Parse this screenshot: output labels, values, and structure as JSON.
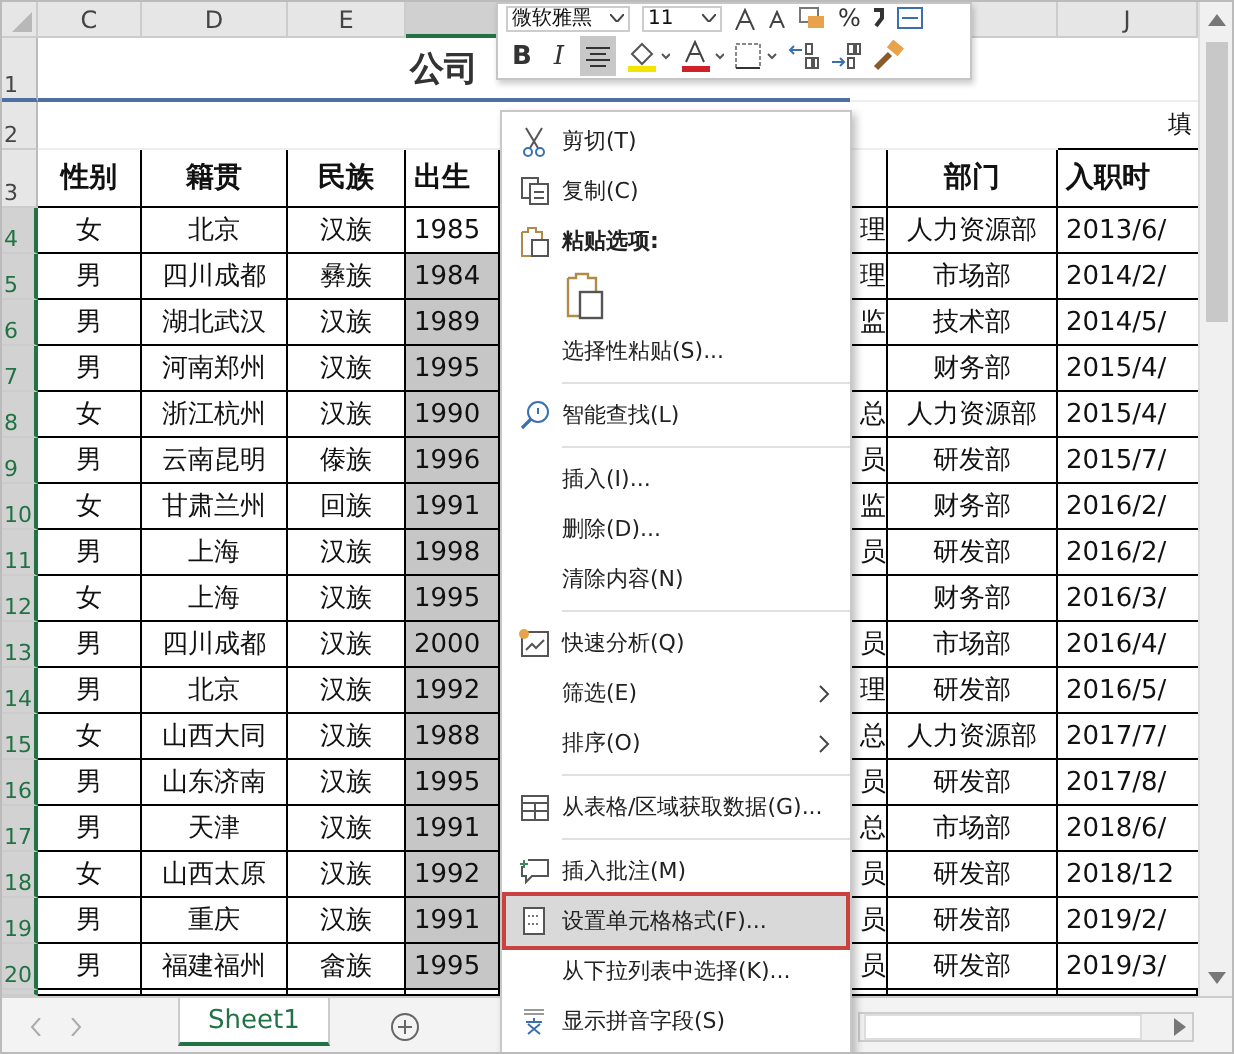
{
  "toolbar": {
    "font": "微软雅黑",
    "size": "11",
    "bold": "B",
    "italic": "I",
    "percent": "%",
    "align_pressed": true
  },
  "column_headers": [
    {
      "label": "C"
    },
    {
      "label": "D"
    },
    {
      "label": "E"
    },
    {
      "label": "J"
    }
  ],
  "title_row": {
    "row": "1",
    "text": "公司"
  },
  "note_row": {
    "row": "2",
    "text": "填"
  },
  "header_row": {
    "row": "3",
    "gender": "性别",
    "origin": "籍贯",
    "ethnicity": "民族",
    "birth": "出生",
    "department": "部门",
    "hire_date": "入职时"
  },
  "rows": [
    {
      "row": "4",
      "selected": true,
      "active": true,
      "gender": "女",
      "origin": "北京",
      "ethnicity": "汉族",
      "birth": "1985",
      "column_h": "理",
      "department": "人力资源部",
      "hire_date": "2013/6/"
    },
    {
      "row": "5",
      "selected": true,
      "active": false,
      "gender": "男",
      "origin": "四川成都",
      "ethnicity": "彝族",
      "birth": "1984",
      "column_h": "理",
      "department": "市场部",
      "hire_date": "2014/2/"
    },
    {
      "row": "6",
      "selected": true,
      "active": false,
      "gender": "男",
      "origin": "湖北武汉",
      "ethnicity": "汉族",
      "birth": "1989",
      "column_h": "监",
      "department": "技术部",
      "hire_date": "2014/5/"
    },
    {
      "row": "7",
      "selected": true,
      "active": false,
      "gender": "男",
      "origin": "河南郑州",
      "ethnicity": "汉族",
      "birth": "1995",
      "department": "财务部",
      "hire_date": "2015/4/"
    },
    {
      "row": "8",
      "selected": true,
      "active": false,
      "gender": "女",
      "origin": "浙江杭州",
      "ethnicity": "汉族",
      "birth": "1990",
      "column_h": "总",
      "department": "人力资源部",
      "hire_date": "2015/4/"
    },
    {
      "row": "9",
      "selected": true,
      "active": false,
      "gender": "男",
      "origin": "云南昆明",
      "ethnicity": "傣族",
      "birth": "1996",
      "column_h": "员",
      "department": "研发部",
      "hire_date": "2015/7/"
    },
    {
      "row": "10",
      "selected": true,
      "active": false,
      "gender": "女",
      "origin": "甘肃兰州",
      "ethnicity": "回族",
      "birth": "1991",
      "column_h": "监",
      "department": "财务部",
      "hire_date": "2016/2/"
    },
    {
      "row": "11",
      "selected": true,
      "active": false,
      "gender": "男",
      "origin": "上海",
      "ethnicity": "汉族",
      "birth": "1998",
      "column_h": "员",
      "department": "研发部",
      "hire_date": "2016/2/"
    },
    {
      "row": "12",
      "selected": true,
      "active": false,
      "gender": "女",
      "origin": "上海",
      "ethnicity": "汉族",
      "birth": "1995",
      "department": "财务部",
      "hire_date": "2016/3/"
    },
    {
      "row": "13",
      "selected": true,
      "active": false,
      "gender": "男",
      "origin": "四川成都",
      "ethnicity": "汉族",
      "birth": "2000",
      "column_h": "员",
      "department": "市场部",
      "hire_date": "2016/4/"
    },
    {
      "row": "14",
      "selected": true,
      "active": false,
      "gender": "男",
      "origin": "北京",
      "ethnicity": "汉族",
      "birth": "1992",
      "column_h": "理",
      "department": "研发部",
      "hire_date": "2016/5/"
    },
    {
      "row": "15",
      "selected": true,
      "active": false,
      "gender": "女",
      "origin": "山西大同",
      "ethnicity": "汉族",
      "birth": "1988",
      "column_h": "总",
      "department": "人力资源部",
      "hire_date": "2017/7/"
    },
    {
      "row": "16",
      "selected": true,
      "active": false,
      "gender": "男",
      "origin": "山东济南",
      "ethnicity": "汉族",
      "birth": "1995",
      "column_h": "员",
      "department": "研发部",
      "hire_date": "2017/8/"
    },
    {
      "row": "17",
      "selected": true,
      "active": false,
      "gender": "男",
      "origin": "天津",
      "ethnicity": "汉族",
      "birth": "1991",
      "column_h": "总",
      "department": "市场部",
      "hire_date": "2018/6/"
    },
    {
      "row": "18",
      "selected": true,
      "active": false,
      "gender": "女",
      "origin": "山西太原",
      "ethnicity": "汉族",
      "birth": "1992",
      "column_h": "员",
      "department": "研发部",
      "hire_date": "2018/12"
    },
    {
      "row": "19",
      "selected": true,
      "active": false,
      "gender": "男",
      "origin": "重庆",
      "ethnicity": "汉族",
      "birth": "1991",
      "column_h": "员",
      "department": "研发部",
      "hire_date": "2019/2/"
    },
    {
      "row": "20",
      "selected": true,
      "active": false,
      "gender": "男",
      "origin": "福建福州",
      "ethnicity": "畲族",
      "birth": "1995",
      "column_h": "员",
      "department": "研发部",
      "hire_date": "2019/3/"
    }
  ],
  "sheet_tabs": [
    {
      "label": "Sheet1",
      "selected": true
    }
  ],
  "context_menu": [
    {
      "kind": "command",
      "label": "剪切(T)",
      "has_submenu": false,
      "selected": false
    },
    {
      "kind": "command",
      "label": "复制(C)",
      "has_submenu": false,
      "selected": false
    },
    {
      "kind": "heading",
      "label": "粘贴选项:"
    },
    {
      "kind": "paste-options"
    },
    {
      "kind": "command",
      "label": "选择性粘贴(S)...",
      "has_submenu": false,
      "selected": false
    },
    {
      "kind": "separator"
    },
    {
      "kind": "command",
      "label": "智能查找(L)",
      "has_submenu": false,
      "selected": false
    },
    {
      "kind": "separator"
    },
    {
      "kind": "command",
      "label": "插入(I)...",
      "has_submenu": false,
      "selected": false
    },
    {
      "kind": "command",
      "label": "删除(D)...",
      "has_submenu": false,
      "selected": false
    },
    {
      "kind": "command",
      "label": "清除内容(N)",
      "has_submenu": false,
      "selected": false
    },
    {
      "kind": "separator"
    },
    {
      "kind": "command",
      "label": "快速分析(Q)",
      "has_submenu": false,
      "selected": false
    },
    {
      "kind": "command",
      "label": "筛选(E)",
      "has_submenu": true,
      "selected": false
    },
    {
      "kind": "command",
      "label": "排序(O)",
      "has_submenu": true,
      "selected": false
    },
    {
      "kind": "separator"
    },
    {
      "kind": "command",
      "label": "从表格/区域获取数据(G)...",
      "has_submenu": false,
      "selected": false
    },
    {
      "kind": "separator"
    },
    {
      "kind": "command",
      "label": "插入批注(M)",
      "has_submenu": false,
      "selected": false
    },
    {
      "kind": "command",
      "label": "设置单元格格式(F)...",
      "has_submenu": false,
      "selected": true
    },
    {
      "kind": "command",
      "label": "从下拉列表中选择(K)...",
      "has_submenu": false,
      "selected": false
    },
    {
      "kind": "command",
      "label": "显示拼音字段(S)",
      "has_submenu": false,
      "selected": false
    }
  ]
}
